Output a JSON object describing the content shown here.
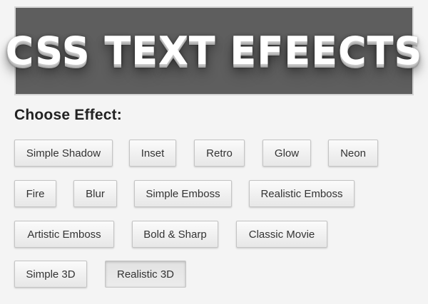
{
  "preview": {
    "text": "CSS TEXT EFEECTS"
  },
  "heading": "Choose Effect:",
  "buttons": [
    {
      "label": "Simple Shadow",
      "active": false
    },
    {
      "label": "Inset",
      "active": false
    },
    {
      "label": "Retro",
      "active": false
    },
    {
      "label": "Glow",
      "active": false
    },
    {
      "label": "Neon",
      "active": false
    },
    {
      "label": "Fire",
      "active": false
    },
    {
      "label": "Blur",
      "active": false
    },
    {
      "label": "Simple Emboss",
      "active": false
    },
    {
      "label": "Realistic Emboss",
      "active": false
    },
    {
      "label": "Artistic Emboss",
      "active": false
    },
    {
      "label": "Bold & Sharp",
      "active": false
    },
    {
      "label": "Classic Movie",
      "active": false
    },
    {
      "label": "Simple 3D",
      "active": false
    },
    {
      "label": "Realistic 3D",
      "active": true
    }
  ],
  "colors": {
    "preview_background": "#5e5e5e",
    "page_background": "#f4f4f4",
    "preview_text": "#ffffff"
  }
}
